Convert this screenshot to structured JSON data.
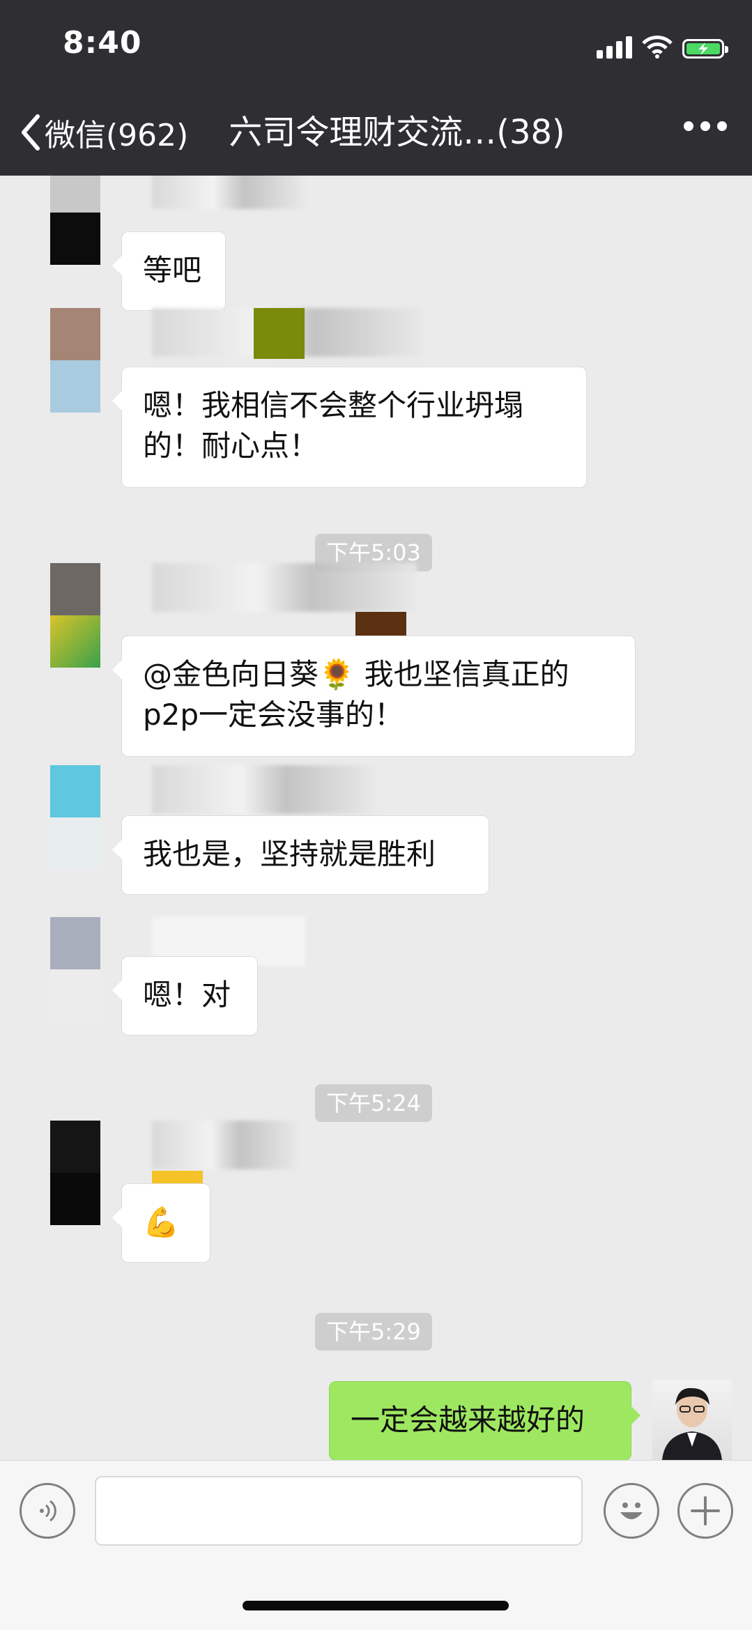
{
  "status_bar": {
    "time": "8:40"
  },
  "nav": {
    "back_label": "微信(962)",
    "title": "六司令理财交流…(38)"
  },
  "messages": [
    {
      "text": "等吧"
    },
    {
      "text": "嗯！我相信不会整个行业坍塌的！耐心点！"
    },
    {
      "text": "@金色向日葵🌻 我也坚信真正的p2p一定会没事的！"
    },
    {
      "text": "我也是，坚持就是胜利"
    },
    {
      "text": "嗯！对"
    },
    {
      "text": "💪"
    },
    {
      "text": "一定会越来越好的"
    }
  ],
  "timestamps": [
    "下午5:03",
    "下午5:24",
    "下午5:29"
  ],
  "colors": {
    "header_bg": "#2e2e33",
    "chat_bg": "#ebebeb",
    "my_bubble": "#9ee861"
  }
}
